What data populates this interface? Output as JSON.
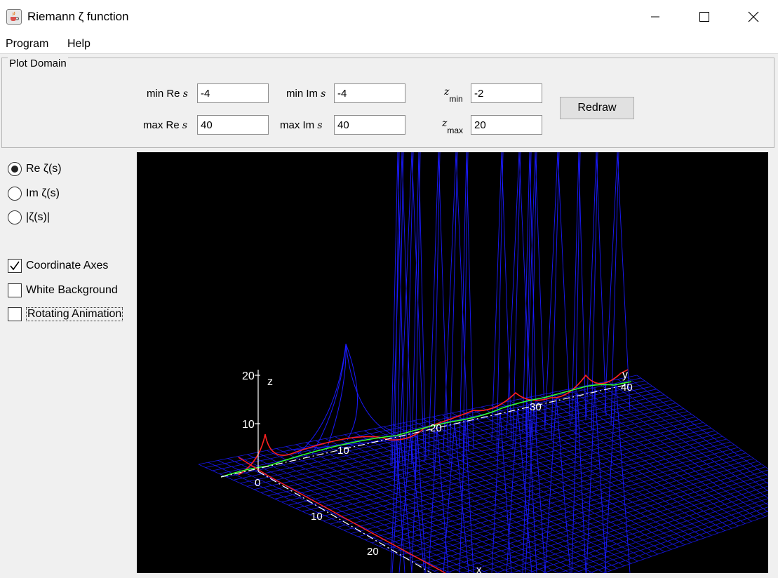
{
  "window": {
    "title": "Riemann ζ function",
    "app_icon": "java-cup-icon",
    "controls": [
      "minimize-icon",
      "maximize-icon",
      "close-icon"
    ]
  },
  "menu": {
    "items": [
      "Program",
      "Help"
    ]
  },
  "plot_domain": {
    "group_title": "Plot Domain",
    "min_re_label": "min Re",
    "max_re_label": "max Re",
    "min_im_label": "min Im",
    "max_im_label": "max Im",
    "s_symbol": "s",
    "z_symbol": "z",
    "zmin_sub": "min",
    "zmax_sub": "max",
    "min_re_value": "-4",
    "max_re_value": "40",
    "min_im_value": "-4",
    "max_im_value": "40",
    "zmin_value": "-2",
    "zmax_value": "20",
    "redraw_label": "Redraw"
  },
  "options": {
    "radios": [
      {
        "label": "Re ζ(s)",
        "selected": true
      },
      {
        "label": "Im ζ(s)",
        "selected": false
      },
      {
        "label": "|ζ(s)|",
        "selected": false
      }
    ],
    "checkboxes": [
      {
        "label": "Coordinate Axes",
        "checked": true
      },
      {
        "label": "White Background",
        "checked": false
      },
      {
        "label": "Rotating Animation",
        "checked": false
      }
    ]
  },
  "plot": {
    "background": "#000000",
    "mesh_color": "#1a1aff",
    "critical_line_red": "#ff2020",
    "critical_line_green": "#30ff30",
    "axis_color": "#ffffff",
    "z_axis_label": "z",
    "y_axis_label": "y",
    "z_ticks": [
      "20",
      "10"
    ],
    "origin_label": "0",
    "real_axis_ticks": [
      "10",
      "20"
    ],
    "imag_axis_ticks": [
      "10",
      "20",
      "30",
      "40"
    ],
    "x_axis_label": "x"
  }
}
